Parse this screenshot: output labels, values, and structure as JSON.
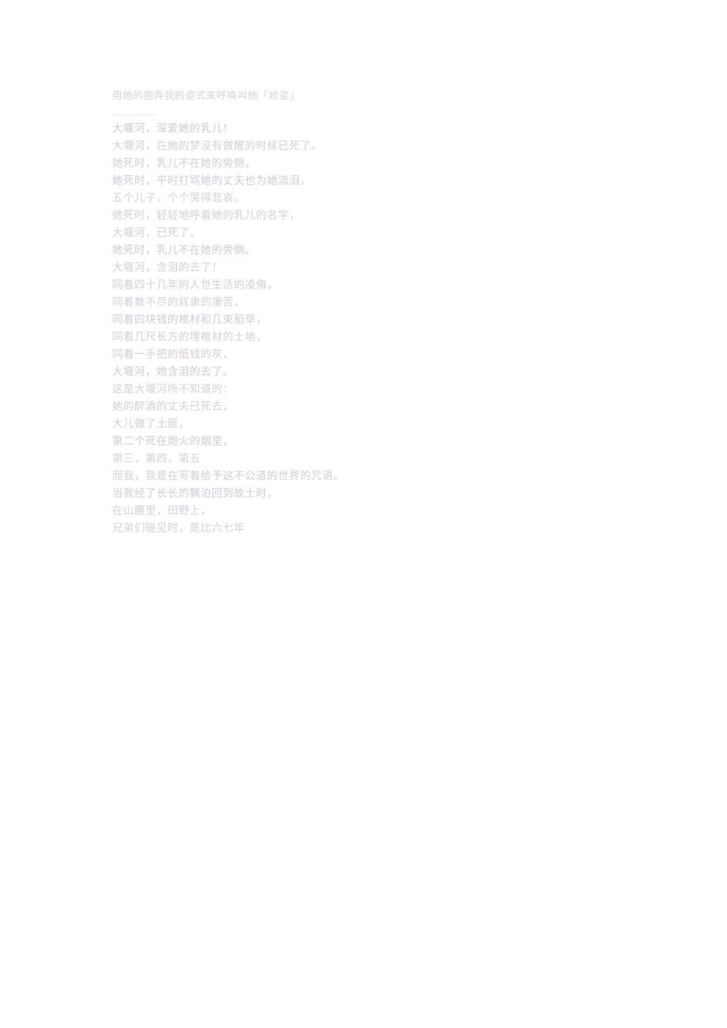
{
  "document": {
    "page_background": "#ffffff",
    "ink_color": "#b0acba",
    "language": "zh",
    "block_title": "",
    "lines": [
      {
        "id": "line-1",
        "text": "用她的抱弄我的姿式来呼唤叫她「娇姿」"
      },
      {
        "id": "line-2",
        "text": "…………"
      },
      {
        "id": "line-3",
        "text": "大堰河，深爱她的乳儿！"
      },
      {
        "id": "line-4",
        "text": "大堰河，在她的梦没有做醒的时候已死了。"
      },
      {
        "id": "line-5",
        "text": "她死时，乳儿不在她的旁侧，"
      },
      {
        "id": "line-6",
        "text": "她死时，平时打骂她的丈夫也为她流泪，"
      },
      {
        "id": "line-7",
        "text": "五个儿子，个个哭得悲哀。"
      },
      {
        "id": "line-8",
        "text": "她死时，轻轻地呼着她的乳儿的名字，"
      },
      {
        "id": "line-9",
        "text": "大堰河，已死了。"
      },
      {
        "id": "line-10",
        "text": "她死时，乳儿不在她的旁侧。"
      },
      {
        "id": "line-11",
        "text": "大堰河，含泪的去了！"
      },
      {
        "id": "line-12",
        "text": "同着四十几年的人世生活的凌侮，"
      },
      {
        "id": "line-13",
        "text": "同着数不尽的奴隶的凄苦，"
      },
      {
        "id": "line-14",
        "text": "同着四块钱的棺材和几束稻草，"
      },
      {
        "id": "line-15",
        "text": "同着几尺长方的埋棺材的土地，"
      },
      {
        "id": "line-16",
        "text": "同着一手把的纸钱的灰，"
      },
      {
        "id": "line-17",
        "text": "大堰河，她含泪的去了。"
      },
      {
        "id": "line-18",
        "text": "这是大堰河所不知道的："
      },
      {
        "id": "line-19",
        "text": "她的醉酒的丈夫已死去，"
      },
      {
        "id": "line-20",
        "text": "大儿做了土匪，"
      },
      {
        "id": "line-21",
        "text": "第二个死在炮火的烟里，"
      },
      {
        "id": "line-22",
        "text": "第三，第四，第五"
      },
      {
        "id": "line-23",
        "text": "而我，我是在写着给予这不公道的世界的咒语。"
      },
      {
        "id": "line-24",
        "text": "当我经了长长的飘泊回到故土时，"
      },
      {
        "id": "line-25",
        "text": "在山腰里，田野上，"
      },
      {
        "id": "line-26",
        "text": "兄弟们碰见时，是比六七年"
      }
    ]
  }
}
